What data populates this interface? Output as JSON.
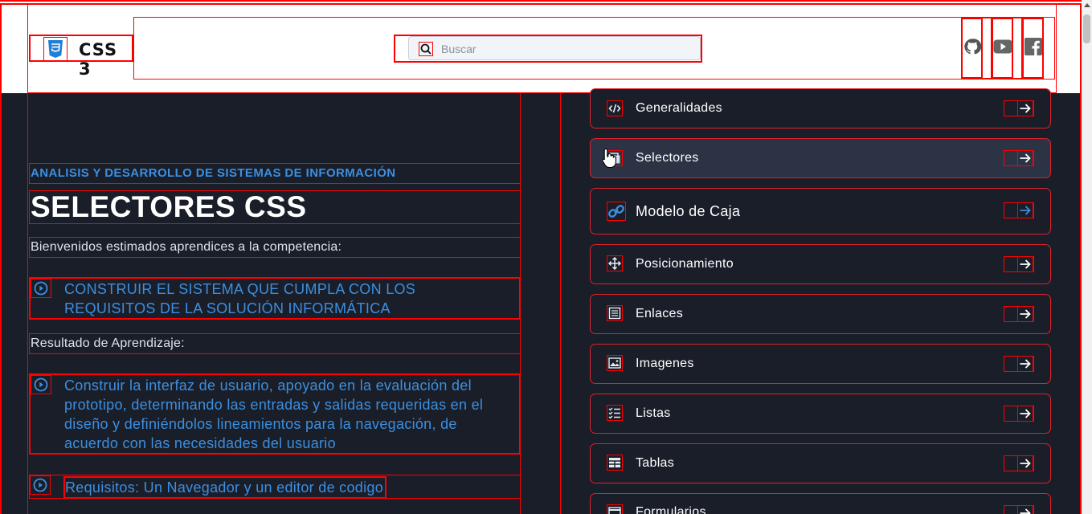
{
  "brand": {
    "name": "CSS 3",
    "logo_icon": "css3-shield-icon"
  },
  "search": {
    "placeholder": "Buscar",
    "icon": "search-icon"
  },
  "social": [
    {
      "name": "github-icon"
    },
    {
      "name": "youtube-icon"
    },
    {
      "name": "facebook-icon"
    }
  ],
  "content": {
    "program": "ANALISIS Y DESARROLLO DE SISTEMAS DE INFORMACIÓN",
    "title": "SELECTORES CSS",
    "welcome": "Bienvenidos estimados aprendices a la competencia:",
    "competence": "CONSTRUIR EL SISTEMA QUE CUMPLA CON LOS REQUISITOS DE LA SOLUCIÓN INFORMÁTICA",
    "outcome_label": "Resultado de Aprendizaje:",
    "outcome": "Construir la interfaz de usuario, apoyado en la evaluación del prototipo, determinando las entradas y salidas requeridas en el diseño y definiéndolos lineamientos para la navegación, de acuerdo con las necesidades del usuario",
    "requirements": "Requisitos: Un Navegador y un editor de codigo"
  },
  "menu": [
    {
      "label": "Generalidades",
      "icon": "code-icon"
    },
    {
      "label": "Selectores",
      "icon": "selector-icon",
      "active": true
    },
    {
      "label": "Modelo de Caja",
      "icon": "link-icon"
    },
    {
      "label": "Posicionamiento",
      "icon": "move-icon"
    },
    {
      "label": "Enlaces",
      "icon": "newspaper-icon"
    },
    {
      "label": "Imagenes",
      "icon": "image-icon"
    },
    {
      "label": "Listas",
      "icon": "list-icon"
    },
    {
      "label": "Tablas",
      "icon": "table-icon"
    },
    {
      "label": "Formularios",
      "icon": "form-icon"
    }
  ],
  "colors": {
    "accent": "#3b8fe0",
    "background": "#1a1e29",
    "active_item": "#2b3345",
    "outline": "#ff0000"
  }
}
